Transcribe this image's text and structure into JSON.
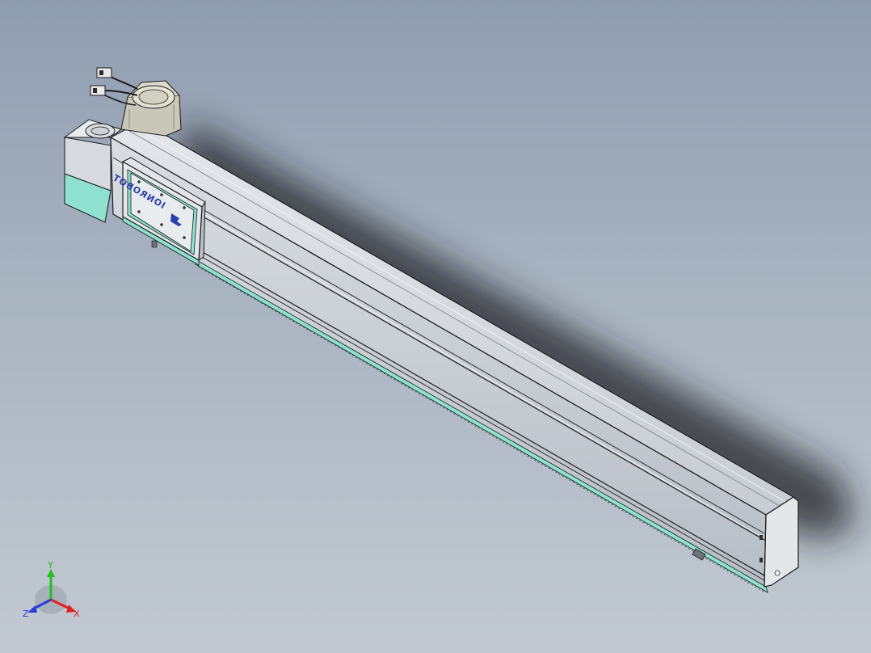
{
  "viewport": {
    "background_top": "#8f9db0",
    "background_bottom": "#c2c9d1"
  },
  "model": {
    "carriage_logo_text": "IONROBOT",
    "colors": {
      "aluminum": "#d5d9de",
      "aluminum_dark": "#9ea5ae",
      "accent_teal": "#8fe2cf",
      "motor": "#c9c8b8",
      "edges": "#1a1a1a",
      "logo_blue": "#2b3fa8"
    }
  },
  "triad": {
    "x_label": "X",
    "y_label": "Y",
    "z_label": "Z",
    "x_color": "#e02020",
    "y_color": "#1ec21e",
    "z_color": "#2a3bd6"
  }
}
